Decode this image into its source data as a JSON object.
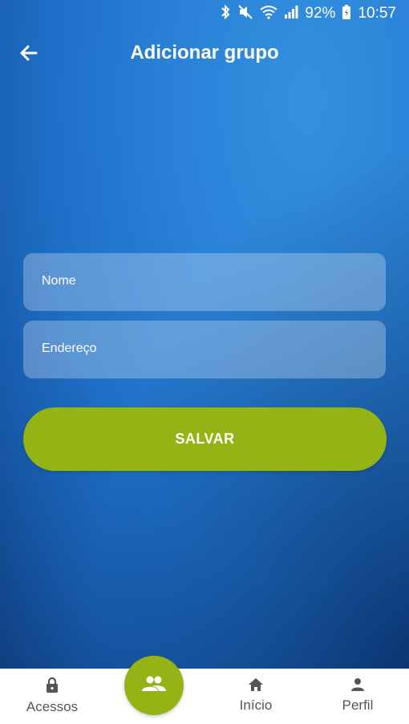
{
  "status_bar": {
    "battery": "92%",
    "time": "10:57",
    "icons": [
      "bluetooth-icon",
      "mute-icon",
      "wifi-icon",
      "signal-icon",
      "battery-icon"
    ]
  },
  "app_bar": {
    "title": "Adicionar grupo",
    "back_icon": "arrow-back-icon"
  },
  "form": {
    "name_placeholder": "Nome",
    "address_placeholder": "Endereço",
    "save_label": "SALVAR"
  },
  "bottom_nav": {
    "items": [
      {
        "label": "Acessos",
        "icon": "lock-icon"
      },
      {
        "label": "",
        "icon": "group-icon"
      },
      {
        "label": "Início",
        "icon": "home-icon"
      },
      {
        "label": "Perfil",
        "icon": "person-icon"
      }
    ]
  },
  "colors": {
    "accent": "#93b414",
    "background_blue": "#2a82d6",
    "nav_text": "#555555"
  }
}
